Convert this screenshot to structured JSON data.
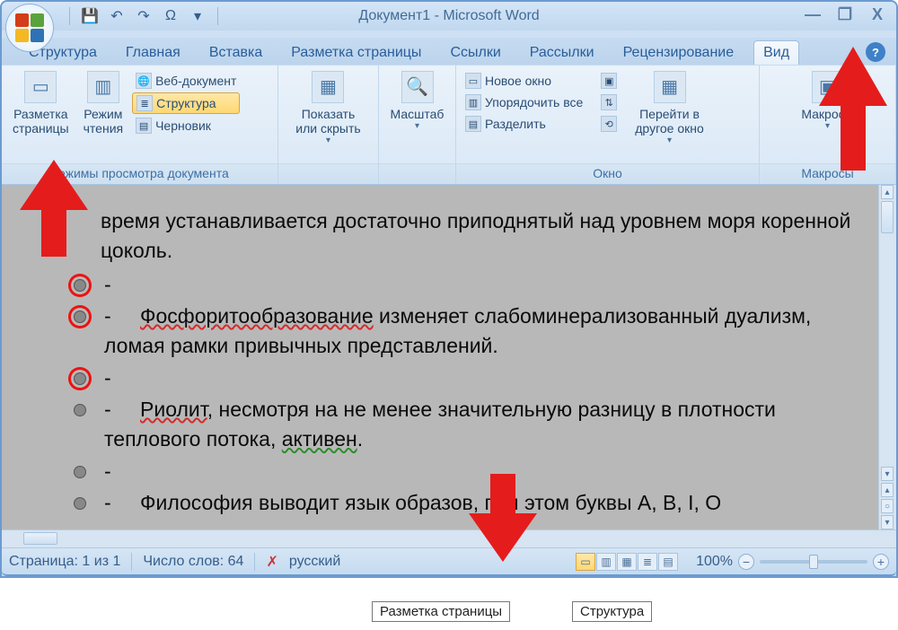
{
  "title": "Документ1 - Microsoft Word",
  "qat": {
    "save": "💾",
    "undo": "↶",
    "redo": "↷",
    "omega": "Ω"
  },
  "win": {
    "min": "—",
    "max": "❐",
    "close": "X"
  },
  "tabs": [
    "Структура",
    "Главная",
    "Вставка",
    "Разметка страницы",
    "Ссылки",
    "Рассылки",
    "Рецензирование",
    "Вид"
  ],
  "active_tab_index": 7,
  "ribbon": {
    "group_views": {
      "label": "Режимы просмотра документа",
      "btn_print": "Разметка\nстраницы",
      "btn_reading": "Режим\nчтения",
      "item_web": "Веб-документ",
      "item_outline": "Структура",
      "item_draft": "Черновик"
    },
    "group_show": {
      "btn": "Показать\nили скрыть"
    },
    "group_zoom": {
      "btn": "Масштаб"
    },
    "group_window": {
      "label": "Окно",
      "new": "Новое окно",
      "arrange": "Упорядочить все",
      "split": "Разделить",
      "switch": "Перейти в\nдругое окно"
    },
    "group_macros": {
      "label": "Макросы",
      "btn": "Макросы"
    }
  },
  "doc": {
    "first_plain": "время устанавливается достаточно приподнятый над уровнем моря коренной цоколь.",
    "rows": [
      {
        "circled": true,
        "text": "-"
      },
      {
        "circled": true,
        "dash": "-",
        "lead_red": "Фосфоритообразование",
        "rest": " изменяет слабоминерализованный дуализм, ломая рамки привычных представлений."
      },
      {
        "circled": true,
        "text": "-"
      },
      {
        "circled": false,
        "dash": "-",
        "lead_red": "Риолит",
        "mid": ", несмотря на не менее значительную разницу в плотности теплового потока, ",
        "tail_green": "активен",
        "end": "."
      },
      {
        "circled": false,
        "text": "-"
      },
      {
        "circled": false,
        "dash": "-",
        "plain": "Философия выводит язык образов, при этом буквы A, B, I, O"
      }
    ]
  },
  "status": {
    "page": "Страница: 1 из 1",
    "words": "Число слов: 64",
    "lang": "русский",
    "zoom": "100%"
  },
  "tooltips": {
    "print_layout": "Разметка страницы",
    "outline": "Структура"
  }
}
